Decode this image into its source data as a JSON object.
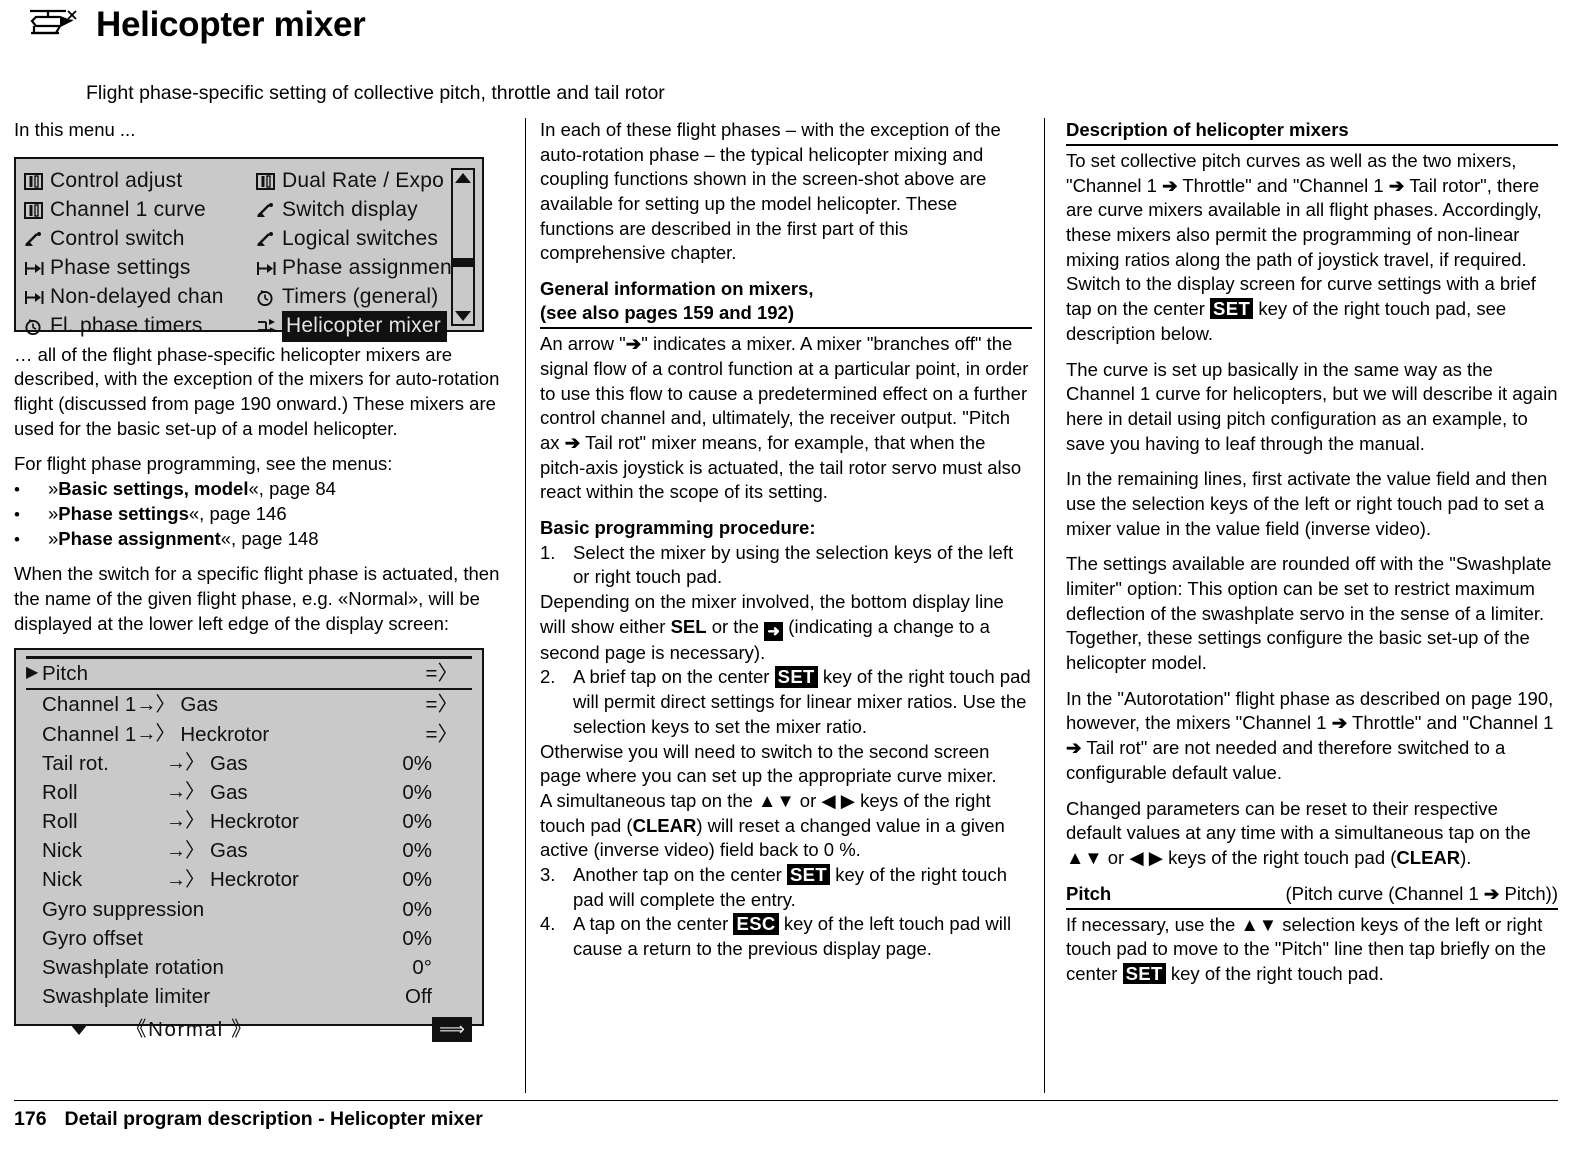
{
  "header": {
    "icon": "helicopter-icon",
    "title": "Helicopter mixer",
    "subtitle": "Flight phase-specific setting of collective pitch, throttle and tail rotor"
  },
  "col1": {
    "intro": "In this menu ...",
    "lcd_menu": {
      "items_left": [
        {
          "icon": "control-adjust-icon",
          "label": "Control adjust",
          "selected": false
        },
        {
          "icon": "channel-curve-icon",
          "label": "Channel 1 curve",
          "selected": false
        },
        {
          "icon": "control-switch-icon",
          "label": "Control switch",
          "selected": false
        },
        {
          "icon": "phase-settings-icon",
          "label": "Phase settings",
          "selected": false
        },
        {
          "icon": "non-delayed-chan-icon",
          "label": "Non-delayed chan",
          "selected": false
        },
        {
          "icon": "fl-phase-timers-icon",
          "label": "Fl. phase timers",
          "selected": false
        }
      ],
      "items_right": [
        {
          "icon": "dual-rate-expo-icon",
          "label": "Dual Rate / Expo",
          "selected": false
        },
        {
          "icon": "switch-display-icon",
          "label": "Switch display",
          "selected": false
        },
        {
          "icon": "logical-switches-icon",
          "label": "Logical switches",
          "selected": false
        },
        {
          "icon": "phase-assignment-icon",
          "label": "Phase assignment",
          "selected": false
        },
        {
          "icon": "timers-general-icon",
          "label": "Timers (general)",
          "selected": false
        },
        {
          "icon": "helicopter-mixer-icon",
          "label": "Helicopter mixer",
          "selected": true
        }
      ]
    },
    "p1": "… all of the flight phase-specific helicopter mixers are described, with the exception of the mixers for auto-rotation flight (discussed from page 190 onward.) These mixers are used for the basic set-up of a model helicopter.",
    "p2": "For flight phase programming, see the menus:",
    "bullets": [
      {
        "dot": "•",
        "open": "»",
        "bold": "Basic settings, model",
        "close": "«, page 84"
      },
      {
        "dot": "•",
        "open": "»",
        "bold": "Phase settings",
        "close": "«, page 146"
      },
      {
        "dot": "•",
        "open": "»",
        "bold": "Phase assignment",
        "close": "«, page 148"
      }
    ],
    "p3": "When the switch for a specific flight phase is actuated, then the name of the given flight phase, e.g. «Normal», will be displayed at the lower left edge of the display screen:",
    "lcd_mixer": {
      "rows": [
        {
          "cursor": "▶",
          "name": "Pitch",
          "arrow": "",
          "target": "",
          "value": "=〉",
          "wide": true,
          "rule_below": true
        },
        {
          "cursor": "",
          "name": "Channel 1",
          "arrow": "→〉",
          "target": "Gas",
          "value": "=〉",
          "wide": true,
          "rule_below": false
        },
        {
          "cursor": "",
          "name": "Channel 1",
          "arrow": "→〉",
          "target": "Heckrotor",
          "value": "=〉",
          "wide": true,
          "rule_below": false
        },
        {
          "cursor": "",
          "name": "Tail rot.",
          "arrow": "→〉",
          "target": "Gas",
          "value": "0%",
          "wide": false,
          "rule_below": false
        },
        {
          "cursor": "",
          "name": "Roll",
          "arrow": "→〉",
          "target": "Gas",
          "value": "0%",
          "wide": false,
          "rule_below": false
        },
        {
          "cursor": "",
          "name": "Roll",
          "arrow": "→〉",
          "target": "Heckrotor",
          "value": "0%",
          "wide": false,
          "rule_below": false
        },
        {
          "cursor": "",
          "name": "Nick",
          "arrow": "→〉",
          "target": "Gas",
          "value": "0%",
          "wide": false,
          "rule_below": false
        },
        {
          "cursor": "",
          "name": "Nick",
          "arrow": "→〉",
          "target": "Heckrotor",
          "value": "0%",
          "wide": false,
          "rule_below": false
        },
        {
          "cursor": "",
          "name": "Gyro suppression",
          "arrow": "",
          "target": "",
          "value": "0%",
          "wide": true,
          "rule_below": false
        },
        {
          "cursor": "",
          "name": "Gyro offset",
          "arrow": "",
          "target": "",
          "value": "0%",
          "wide": true,
          "rule_below": false
        },
        {
          "cursor": "",
          "name": "Swashplate rotation",
          "arrow": "",
          "target": "",
          "value": "0°",
          "wide": true,
          "rule_below": false
        },
        {
          "cursor": "",
          "name": "Swashplate limiter",
          "arrow": "",
          "target": "",
          "value": "Off",
          "wide": true,
          "rule_below": false
        }
      ],
      "phase_label": "《Normal 》",
      "next_page_icon": "⟹"
    }
  },
  "col2": {
    "p1": "In each of these flight phases – with the exception of the auto-rotation phase – the typical helicopter mixing and coupling functions shown in the screen-shot above are available for setting up the model helicopter. These functions are described in the first part of this comprehensive chapter.",
    "h1_line1": "General information on mixers,",
    "h1_line2": "(see also pages 159 and 192)",
    "p2_a": "An arrow \"",
    "p2_arrow": "➔",
    "p2_b": "\" indicates a mixer. A mixer \"branches off\" the signal flow of a control function at a particular point, in order to use this flow to cause a predetermined effect on a further control channel and, ultimately, the receiver output. \"Pitch ax ",
    "p2_c": " Tail rot\" mixer means, for example, that when the pitch-axis joystick is actuated, the tail rotor servo must also react within the scope of its setting.",
    "h2": "Basic programming procedure:",
    "steps": [
      {
        "num": "1.",
        "text": "Select the mixer by using the selection keys of the left or right touch pad.",
        "sub_a": "Depending on the mixer involved, the bottom display line will show either ",
        "sub_key1": "SEL",
        "sub_b": " or the ",
        "sub_icon": "arrow-right-box-icon",
        "sub_c": " (indicating a change to a second page is necessary)."
      },
      {
        "num": "2.",
        "text_a": "A brief tap on the center ",
        "key": "SET",
        "text_b": " key of the right touch pad will permit direct settings for linear mixer ratios. Use the selection keys to set the mixer ratio.",
        "sub1": "Otherwise you will need to switch to the second screen page where you can set up the appropriate curve mixer.",
        "sub2_a": "A simultaneous tap on the ",
        "sub2_keys1": "▲▼",
        "sub2_b": " or ",
        "sub2_keys2": "◀ ▶",
        "sub2_c": " keys of the right touch pad (",
        "sub2_clear": "CLEAR",
        "sub2_d": ") will reset a changed value in a given active (inverse video) field back to 0 %."
      },
      {
        "num": "3.",
        "text_a": "Another tap on the center ",
        "key": "SET",
        "text_b": " key of the right touch pad will complete the entry."
      },
      {
        "num": "4.",
        "text_a": "A tap on the center ",
        "key": "ESC",
        "text_b": " key of the left touch pad will cause a return to the previous display page."
      }
    ]
  },
  "col3": {
    "h1": "Description of helicopter mixers",
    "p1_a": "To set collective pitch curves as well as the two mixers, \"Channel 1 ",
    "p1_b": " Throttle\" and \"Channel 1 ",
    "p1_c": " Tail rotor\", there are curve mixers available in all flight phases. Accordingly, these mixers also permit the programming of non-linear mixing ratios along the path of joystick travel, if required. Switch to the display screen for curve settings with a brief tap on the center ",
    "p1_key": "SET",
    "p1_d": " key of the right touch pad, see description below.",
    "p2": "The curve is set up basically in the same way as the Channel 1 curve for helicopters, but we will describe it again here in detail using pitch configuration as an example, to save you having to leaf through the manual.",
    "p3": "In the remaining lines, first activate the value field and then use the selection keys of the left or right touch pad to set a mixer value in the value field (inverse video).",
    "p4": "The settings available are rounded off with the \"Swashplate limiter\" option: This option can be set to restrict maximum deflection of the swashplate servo in the sense of a limiter. Together, these settings configure the basic set-up of the helicopter model.",
    "p5_a": "In the \"Autorotation\" flight phase as described on page 190, however, the mixers \"Channel 1 ",
    "p5_b": " Throttle\" and \"Channel 1 ",
    "p5_c": " Tail rot\" are not needed and therefore switched to a configurable default value.",
    "p6_a": "Changed parameters can be reset to their respective default values at any time with a simultaneous tap on the ",
    "p6_keys1": "▲▼",
    "p6_b": " or ",
    "p6_keys2": "◀ ▶",
    "p6_c": " keys of the right touch pad (",
    "p6_clear": "CLEAR",
    "p6_d": ").",
    "h2_left": "Pitch",
    "h2_right_a": "(Pitch curve (Channel 1 ",
    "h2_right_b": " Pitch))",
    "p7_a": "If necessary, use the ",
    "p7_keys": "▲▼",
    "p7_b": " selection keys of the left or right touch pad to move to the \"Pitch\" line then tap briefly on the center ",
    "p7_key": "SET",
    "p7_c": " key of the right touch pad."
  },
  "footer": {
    "page_number": "176",
    "text": "Detail program description - Helicopter mixer"
  }
}
